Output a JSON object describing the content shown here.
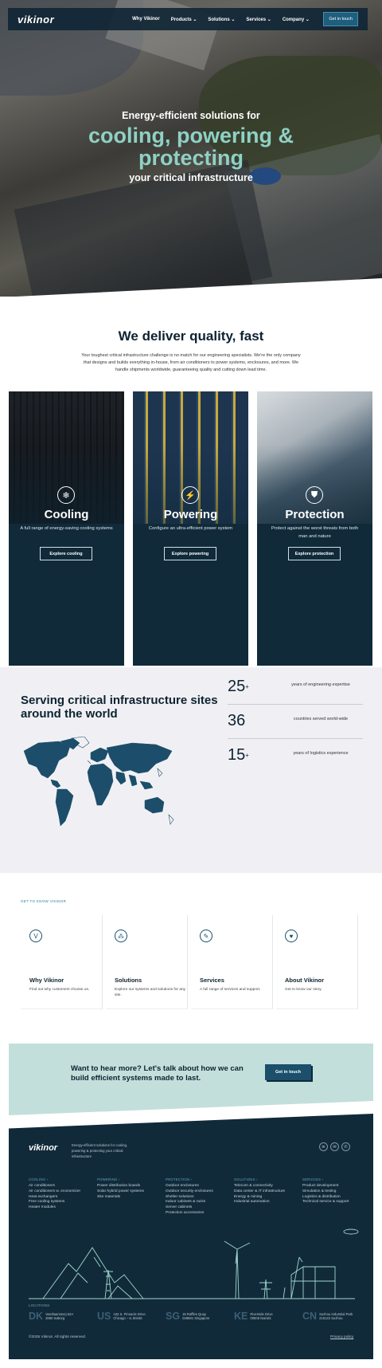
{
  "nav": {
    "logo": "vikinor",
    "links": [
      "Why Vikinor",
      "Products ⌄",
      "Solutions ⌄",
      "Services ⌄",
      "Company ⌄"
    ],
    "cta": "Get in touch"
  },
  "hero": {
    "line1": "Energy-efficient solutions for",
    "line2a": "cooling, powering &",
    "line2b": "protecting",
    "line3": "your critical infrastructure"
  },
  "quality": {
    "title": "We deliver quality, fast",
    "body": "Your toughest critical infrastructure challenge is no match for our engineering specialists. We're the only company that designs and builds everything in-house, from air conditioners to power systems, enclosures, and more. We handle shipments worldwide, guaranteeing quality and cutting down lead time."
  },
  "cards": [
    {
      "title": "Cooling",
      "text": "A full range of energy-saving cooling systems",
      "button": "Explore cooling",
      "icon": "snowflake-icon"
    },
    {
      "title": "Powering",
      "text": "Configure an ultra-efficient power system",
      "button": "Explore powering",
      "icon": "lightning-icon"
    },
    {
      "title": "Protection",
      "text": "Protect against the worst threats from both man and nature",
      "button": "Explore protection",
      "icon": "shield-icon"
    }
  ],
  "world": {
    "title": "Serving critical infrastructure sites around the world",
    "stats": [
      {
        "value": "25",
        "suffix": "+",
        "label": "years of engineering expertise"
      },
      {
        "value": "36",
        "suffix": "",
        "label": "countries served world-wide"
      },
      {
        "value": "15",
        "suffix": "+",
        "label": "years of logistics experience"
      }
    ]
  },
  "know": {
    "tag": "GET TO KNOW VIKINOR",
    "cards": [
      {
        "title": "Why Vikinor",
        "text": "Find out why customers choose us.",
        "icon": "v-badge-icon"
      },
      {
        "title": "Solutions",
        "text": "Explore our systems and solutions for any site.",
        "icon": "cluster-icon"
      },
      {
        "title": "Services",
        "text": "A full range of services and support.",
        "icon": "wrench-icon"
      },
      {
        "title": "About Vikinor",
        "text": "Get to know our story.",
        "icon": "heart-icon"
      }
    ]
  },
  "cta": {
    "text": "Want to hear more? Let's talk about how we can build efficient systems made to last.",
    "button": "Get in touch"
  },
  "footer": {
    "logo": "vikinor",
    "tagline": "Energy-efficient solutions for cooling, powering & protecting your critical infrastructure",
    "columns": [
      {
        "heading": "COOLING ›",
        "items": [
          "Air conditioners",
          "Air conditioners w. economizer",
          "Heat exchangers",
          "Free cooling systems",
          "Heater modules"
        ]
      },
      {
        "heading": "POWERING ›",
        "items": [
          "Power distribution boards",
          "Solar hybrid power systems",
          "Site materials"
        ]
      },
      {
        "heading": "PROTECTION ›",
        "items": [
          "Outdoor enclosures",
          "Outdoor security enclosures",
          "Shelter solutions",
          "Indoor cabinets & racks",
          "Server cabinets",
          "Protection accessories"
        ]
      },
      {
        "heading": "SOLUTIONS ›",
        "items": [
          "Telecom & connectivity",
          "Data center & IT infrastructure",
          "Energy & mining",
          "Industrial automation"
        ]
      },
      {
        "heading": "SERVICES ›",
        "items": [
          "Product development",
          "Simulation & testing",
          "Logistics & distribution",
          "Technical service & support"
        ]
      }
    ],
    "locations_heading": "LOCATIONS",
    "locations": [
      {
        "code": "DK",
        "line1": "Vandtaarnsvej 62A",
        "line2": "2860 Søborg"
      },
      {
        "code": "US",
        "line1": "162 S. Pinnacle Drive",
        "line2": "Chicago – IL 60446"
      },
      {
        "code": "SG",
        "line1": "18 Raffles Quay",
        "line2": "048581 Singapore"
      },
      {
        "code": "KE",
        "line1": "Riverside Drive",
        "line2": "00505 Nairobi"
      },
      {
        "code": "CN",
        "line1": "Suzhou Industrial Park",
        "line2": "215122 Suzhou"
      }
    ],
    "copyright": "©2025 Vikinor. All rights reserved.",
    "privacy": "Privacy policy"
  }
}
